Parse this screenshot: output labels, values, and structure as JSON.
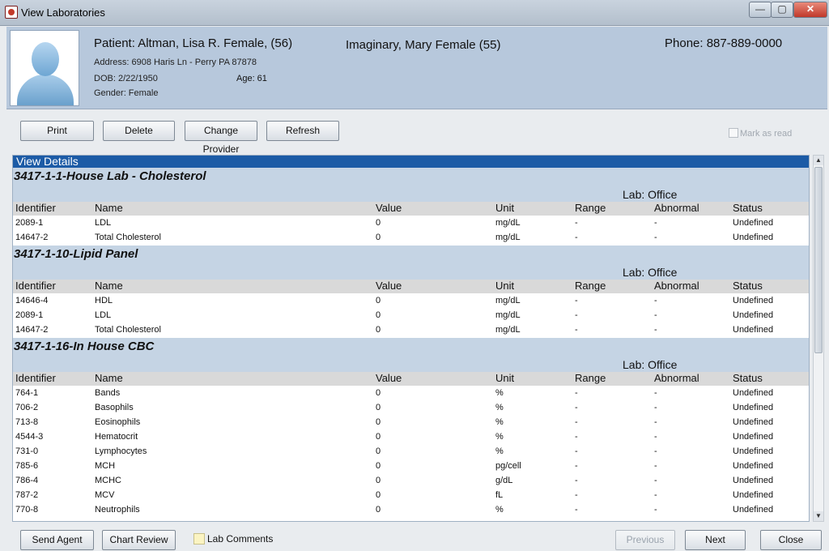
{
  "window": {
    "title": "View Laboratories",
    "min_glyph": "—",
    "max_glyph": "▢",
    "close_glyph": "✕"
  },
  "patient": {
    "name_line": "Patient: Altman, Lisa R. Female, (56)",
    "address": "Address: 6908 Haris Ln - Perry PA 87878",
    "dob": "DOB: 2/22/1950",
    "age": "Age: 61",
    "gender": "Gender: Female",
    "provider": "Imaginary, Mary Female (55)",
    "phone": "Phone: 887-889-0000"
  },
  "toolbar": {
    "print": "Print",
    "delete": "Delete",
    "change_provider": "Change Provider",
    "refresh": "Refresh",
    "mark_as_read": "Mark as read"
  },
  "view": {
    "header": "View Details",
    "columns": {
      "identifier": "Identifier",
      "name": "Name",
      "value": "Value",
      "unit": "Unit",
      "range": "Range",
      "abnormal": "Abnormal",
      "status": "Status"
    },
    "labs": [
      {
        "title": "3417-1-1-House Lab - Cholesterol",
        "place": "Lab: Office",
        "rows": [
          {
            "id": "2089-1",
            "name": "LDL",
            "value": "0",
            "unit": "mg/dL",
            "range": "-",
            "abnormal": "-",
            "status": "Undefined"
          },
          {
            "id": "14647-2",
            "name": "Total Cholesterol",
            "value": "0",
            "unit": "mg/dL",
            "range": "-",
            "abnormal": "-",
            "status": "Undefined"
          }
        ]
      },
      {
        "title": "3417-1-10-Lipid Panel",
        "place": "Lab: Office",
        "rows": [
          {
            "id": "14646-4",
            "name": "HDL",
            "value": "0",
            "unit": "mg/dL",
            "range": "-",
            "abnormal": "-",
            "status": "Undefined"
          },
          {
            "id": "2089-1",
            "name": "LDL",
            "value": "0",
            "unit": "mg/dL",
            "range": "-",
            "abnormal": "-",
            "status": "Undefined"
          },
          {
            "id": "14647-2",
            "name": "Total Cholesterol",
            "value": "0",
            "unit": "mg/dL",
            "range": "-",
            "abnormal": "-",
            "status": "Undefined"
          }
        ]
      },
      {
        "title": "3417-1-16-In House CBC",
        "place": "Lab: Office",
        "rows": [
          {
            "id": "764-1",
            "name": "Bands",
            "value": "0",
            "unit": "%",
            "range": "-",
            "abnormal": "-",
            "status": "Undefined"
          },
          {
            "id": "706-2",
            "name": "Basophils",
            "value": "0",
            "unit": "%",
            "range": "-",
            "abnormal": "-",
            "status": "Undefined"
          },
          {
            "id": "713-8",
            "name": "Eosinophils",
            "value": "0",
            "unit": "%",
            "range": "-",
            "abnormal": "-",
            "status": "Undefined"
          },
          {
            "id": "4544-3",
            "name": "Hematocrit",
            "value": "0",
            "unit": "%",
            "range": "-",
            "abnormal": "-",
            "status": "Undefined"
          },
          {
            "id": "731-0",
            "name": "Lymphocytes",
            "value": "0",
            "unit": "%",
            "range": "-",
            "abnormal": "-",
            "status": "Undefined"
          },
          {
            "id": "785-6",
            "name": "MCH",
            "value": "0",
            "unit": "pg/cell",
            "range": "-",
            "abnormal": "-",
            "status": "Undefined"
          },
          {
            "id": "786-4",
            "name": "MCHC",
            "value": "0",
            "unit": "g/dL",
            "range": "-",
            "abnormal": "-",
            "status": "Undefined"
          },
          {
            "id": "787-2",
            "name": "MCV",
            "value": "0",
            "unit": "fL",
            "range": "-",
            "abnormal": "-",
            "status": "Undefined"
          },
          {
            "id": "770-8",
            "name": "Neutrophils",
            "value": "0",
            "unit": "%",
            "range": "-",
            "abnormal": "-",
            "status": "Undefined"
          }
        ]
      }
    ]
  },
  "footer": {
    "send_agent": "Send Agent",
    "chart_review": "Chart Review",
    "lab_comments": "Lab Comments",
    "previous": "Previous",
    "next": "Next",
    "close": "Close"
  }
}
